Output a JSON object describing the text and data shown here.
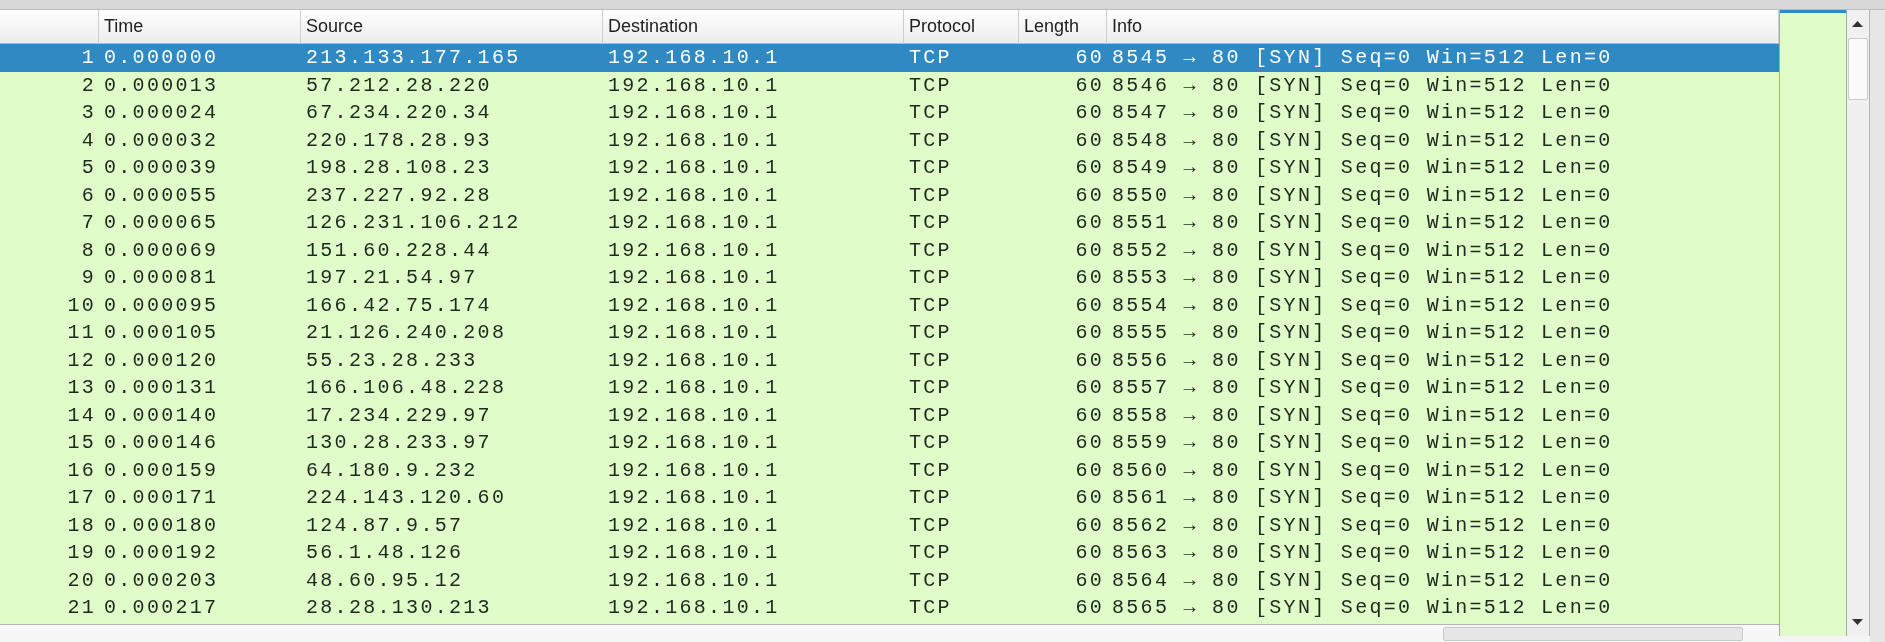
{
  "table": {
    "columns": [
      {
        "label": "Time"
      },
      {
        "label": "Source"
      },
      {
        "label": "Destination"
      },
      {
        "label": "Protocol"
      },
      {
        "label": "Length"
      },
      {
        "label": "Info"
      }
    ],
    "rows": [
      {
        "no": "1",
        "time": "0.000000",
        "source": "213.133.177.165",
        "destination": "192.168.10.1",
        "protocol": "TCP",
        "length": "60",
        "info": "8545 → 80 [SYN] Seq=0 Win=512 Len=0",
        "selected": true
      },
      {
        "no": "2",
        "time": "0.000013",
        "source": "57.212.28.220",
        "destination": "192.168.10.1",
        "protocol": "TCP",
        "length": "60",
        "info": "8546 → 80 [SYN] Seq=0 Win=512 Len=0",
        "selected": false
      },
      {
        "no": "3",
        "time": "0.000024",
        "source": "67.234.220.34",
        "destination": "192.168.10.1",
        "protocol": "TCP",
        "length": "60",
        "info": "8547 → 80 [SYN] Seq=0 Win=512 Len=0",
        "selected": false
      },
      {
        "no": "4",
        "time": "0.000032",
        "source": "220.178.28.93",
        "destination": "192.168.10.1",
        "protocol": "TCP",
        "length": "60",
        "info": "8548 → 80 [SYN] Seq=0 Win=512 Len=0",
        "selected": false
      },
      {
        "no": "5",
        "time": "0.000039",
        "source": "198.28.108.23",
        "destination": "192.168.10.1",
        "protocol": "TCP",
        "length": "60",
        "info": "8549 → 80 [SYN] Seq=0 Win=512 Len=0",
        "selected": false
      },
      {
        "no": "6",
        "time": "0.000055",
        "source": "237.227.92.28",
        "destination": "192.168.10.1",
        "protocol": "TCP",
        "length": "60",
        "info": "8550 → 80 [SYN] Seq=0 Win=512 Len=0",
        "selected": false
      },
      {
        "no": "7",
        "time": "0.000065",
        "source": "126.231.106.212",
        "destination": "192.168.10.1",
        "protocol": "TCP",
        "length": "60",
        "info": "8551 → 80 [SYN] Seq=0 Win=512 Len=0",
        "selected": false
      },
      {
        "no": "8",
        "time": "0.000069",
        "source": "151.60.228.44",
        "destination": "192.168.10.1",
        "protocol": "TCP",
        "length": "60",
        "info": "8552 → 80 [SYN] Seq=0 Win=512 Len=0",
        "selected": false
      },
      {
        "no": "9",
        "time": "0.000081",
        "source": "197.21.54.97",
        "destination": "192.168.10.1",
        "protocol": "TCP",
        "length": "60",
        "info": "8553 → 80 [SYN] Seq=0 Win=512 Len=0",
        "selected": false
      },
      {
        "no": "10",
        "time": "0.000095",
        "source": "166.42.75.174",
        "destination": "192.168.10.1",
        "protocol": "TCP",
        "length": "60",
        "info": "8554 → 80 [SYN] Seq=0 Win=512 Len=0",
        "selected": false
      },
      {
        "no": "11",
        "time": "0.000105",
        "source": "21.126.240.208",
        "destination": "192.168.10.1",
        "protocol": "TCP",
        "length": "60",
        "info": "8555 → 80 [SYN] Seq=0 Win=512 Len=0",
        "selected": false
      },
      {
        "no": "12",
        "time": "0.000120",
        "source": "55.23.28.233",
        "destination": "192.168.10.1",
        "protocol": "TCP",
        "length": "60",
        "info": "8556 → 80 [SYN] Seq=0 Win=512 Len=0",
        "selected": false
      },
      {
        "no": "13",
        "time": "0.000131",
        "source": "166.106.48.228",
        "destination": "192.168.10.1",
        "protocol": "TCP",
        "length": "60",
        "info": "8557 → 80 [SYN] Seq=0 Win=512 Len=0",
        "selected": false
      },
      {
        "no": "14",
        "time": "0.000140",
        "source": "17.234.229.97",
        "destination": "192.168.10.1",
        "protocol": "TCP",
        "length": "60",
        "info": "8558 → 80 [SYN] Seq=0 Win=512 Len=0",
        "selected": false
      },
      {
        "no": "15",
        "time": "0.000146",
        "source": "130.28.233.97",
        "destination": "192.168.10.1",
        "protocol": "TCP",
        "length": "60",
        "info": "8559 → 80 [SYN] Seq=0 Win=512 Len=0",
        "selected": false
      },
      {
        "no": "16",
        "time": "0.000159",
        "source": "64.180.9.232",
        "destination": "192.168.10.1",
        "protocol": "TCP",
        "length": "60",
        "info": "8560 → 80 [SYN] Seq=0 Win=512 Len=0",
        "selected": false
      },
      {
        "no": "17",
        "time": "0.000171",
        "source": "224.143.120.60",
        "destination": "192.168.10.1",
        "protocol": "TCP",
        "length": "60",
        "info": "8561 → 80 [SYN] Seq=0 Win=512 Len=0",
        "selected": false
      },
      {
        "no": "18",
        "time": "0.000180",
        "source": "124.87.9.57",
        "destination": "192.168.10.1",
        "protocol": "TCP",
        "length": "60",
        "info": "8562 → 80 [SYN] Seq=0 Win=512 Len=0",
        "selected": false
      },
      {
        "no": "19",
        "time": "0.000192",
        "source": "56.1.48.126",
        "destination": "192.168.10.1",
        "protocol": "TCP",
        "length": "60",
        "info": "8563 → 80 [SYN] Seq=0 Win=512 Len=0",
        "selected": false
      },
      {
        "no": "20",
        "time": "0.000203",
        "source": "48.60.95.12",
        "destination": "192.168.10.1",
        "protocol": "TCP",
        "length": "60",
        "info": "8564 → 80 [SYN] Seq=0 Win=512 Len=0",
        "selected": false
      },
      {
        "no": "21",
        "time": "0.000217",
        "source": "28.28.130.213",
        "destination": "192.168.10.1",
        "protocol": "TCP",
        "length": "60",
        "info": "8565 → 80 [SYN] Seq=0 Win=512 Len=0",
        "selected": false
      }
    ]
  }
}
